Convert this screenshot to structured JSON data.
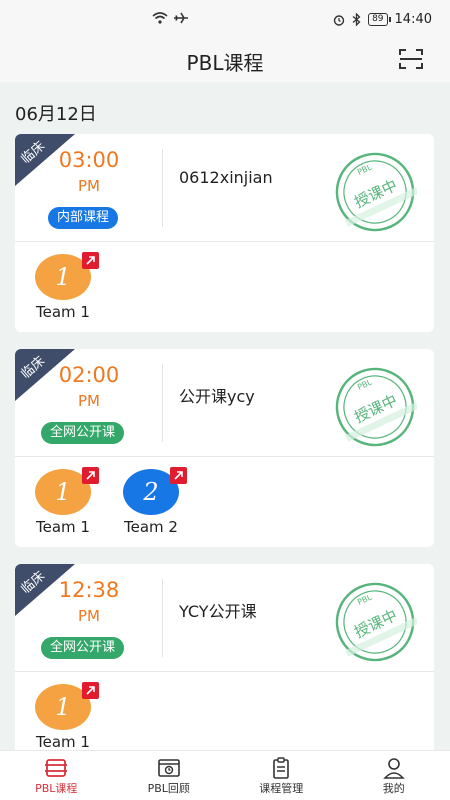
{
  "status_bar": {
    "time": "14:40",
    "battery": "89"
  },
  "header": {
    "title": "PBL课程"
  },
  "date_label": "06月12日",
  "courses": [
    {
      "ribbon": "临床",
      "time": "03:00",
      "ampm": "PM",
      "tag": "内部课程",
      "tag_color": "#1677e5",
      "name": "0612xinjian",
      "stamp": "授课中",
      "stamp_top": "PBL",
      "teams": [
        {
          "number": "1",
          "label": "Team 1",
          "color": "#f5a242"
        }
      ]
    },
    {
      "ribbon": "临床",
      "time": "02:00",
      "ampm": "PM",
      "tag": "全网公开课",
      "tag_color": "#34a86a",
      "name": "公开课ycy",
      "stamp": "授课中",
      "stamp_top": "PBL",
      "teams": [
        {
          "number": "1",
          "label": "Team 1",
          "color": "#f5a242"
        },
        {
          "number": "2",
          "label": "Team 2",
          "color": "#1677e5"
        }
      ]
    },
    {
      "ribbon": "临床",
      "time": "12:38",
      "ampm": "PM",
      "tag": "全网公开课",
      "tag_color": "#34a86a",
      "name": "YCY公开课",
      "stamp": "授课中",
      "stamp_top": "PBL",
      "teams": [
        {
          "number": "1",
          "label": "Team 1",
          "color": "#f5a242"
        }
      ]
    }
  ],
  "tab_bar": [
    {
      "label": "PBL课程",
      "icon": "course-icon",
      "active": true
    },
    {
      "label": "PBL回顾",
      "icon": "review-icon",
      "active": false
    },
    {
      "label": "课程管理",
      "icon": "clipboard-icon",
      "active": false
    },
    {
      "label": "我的",
      "icon": "profile-icon",
      "active": false
    }
  ],
  "colors": {
    "accent": "#f07820",
    "active_tab": "#d8303a",
    "stamp": "#3aa864",
    "ribbon": "#3f4d6b"
  }
}
